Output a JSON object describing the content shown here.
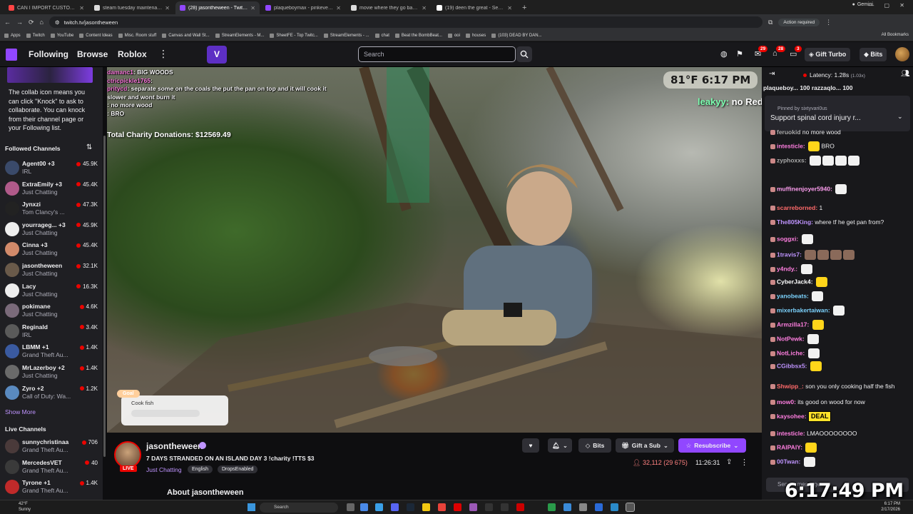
{
  "browser": {
    "tabs": [
      {
        "title": "CAN I IMPORT CUSTOM MOVIE",
        "color": "#ff4444",
        "active": false
      },
      {
        "title": "steam tuesday maintenance - G",
        "color": "#ddd",
        "active": false
      },
      {
        "title": "(28) jasontheween - Twitch",
        "color": "#9147ff",
        "active": true
      },
      {
        "title": "plaqueboymax - pinkeverywhe",
        "color": "#9147ff",
        "active": false
      },
      {
        "title": "movie where they go back in ti",
        "color": "#ddd",
        "active": false
      },
      {
        "title": "(19) deen the great - Search / X",
        "color": "#fff",
        "active": false
      }
    ],
    "new_tab": "+",
    "profile": "Gemini",
    "url": "twitch.tv/jasontheween",
    "action_required": "Action required",
    "bookmarks": [
      "Apps",
      "Twitch",
      "YouTube",
      "Content Ideas",
      "Misc. Room stuff",
      "Canvas and Wall St...",
      "StreamElements - M...",
      "SheetFE - Top Twitc...",
      "StreamElements - ...",
      "chat",
      "Beat the BombBeat...",
      "ooi",
      "houses",
      "(103) DEAD BY DAN..."
    ],
    "all_bookmarks": "All Bookmarks"
  },
  "topnav": {
    "following": "Following",
    "browse": "Browse",
    "roblox": "Roblox",
    "search_placeholder": "Search",
    "notif_count_1": "29",
    "notif_count_2": "28",
    "notif_count_3": "3",
    "gift_turbo": "Gift Turbo",
    "bits": "Bits"
  },
  "sidebar": {
    "collab_text": "The collab icon means you can click \"Knock\" to ask to collaborate. You can knock from their channel page or your Following list.",
    "followed_header": "Followed Channels",
    "followed": [
      {
        "name": "Agent00 +3",
        "game": "IRL",
        "viewers": "45.9K",
        "color": "#3a4a6a"
      },
      {
        "name": "ExtraEmily +3",
        "game": "Just Chatting",
        "viewers": "45.4K",
        "color": "#b05a8a"
      },
      {
        "name": "Jynxzi",
        "game": "Tom Clancy's ...",
        "viewers": "47.3K",
        "color": "#222"
      },
      {
        "name": "yourrageg... +3",
        "game": "Just Chatting",
        "viewers": "45.9K",
        "color": "#eee"
      },
      {
        "name": "Cinna +3",
        "game": "Just Chatting",
        "viewers": "45.4K",
        "color": "#d28a6a"
      },
      {
        "name": "jasontheween",
        "game": "Just Chatting",
        "viewers": "32.1K",
        "color": "#6a5a4a"
      },
      {
        "name": "Lacy",
        "game": "Just Chatting",
        "viewers": "16.3K",
        "color": "#eee"
      },
      {
        "name": "pokimane",
        "game": "Just Chatting",
        "viewers": "4.6K",
        "color": "#7a6a7a"
      },
      {
        "name": "Reginald",
        "game": "IRL",
        "viewers": "3.4K",
        "color": "#5a5a5a"
      },
      {
        "name": "LBMM +1",
        "game": "Grand Theft Au...",
        "viewers": "1.4K",
        "color": "#3a5aa0"
      },
      {
        "name": "MrLazerboy +2",
        "game": "Just Chatting",
        "viewers": "1.4K",
        "color": "#6a6a6a"
      },
      {
        "name": "Zyro +2",
        "game": "Call of Duty: Wa...",
        "viewers": "1.2K",
        "color": "#5a8ac0"
      }
    ],
    "show_more": "Show More",
    "live_header": "Live Channels",
    "live": [
      {
        "name": "sunnychristinaa",
        "game": "Grand Theft Au...",
        "viewers": "706",
        "color": "#4a3a3a"
      },
      {
        "name": "MercedesVET",
        "game": "Grand Theft Au...",
        "viewers": "40",
        "color": "#3a3a3a"
      },
      {
        "name": "Tyrone +1",
        "game": "Grand Theft Au...",
        "viewers": "1.4K",
        "color": "#c02a2a"
      }
    ]
  },
  "video": {
    "overlay_chat": [
      {
        "user": "damanc1",
        "text": "BIG WOODS"
      },
      {
        "user": "ctricpickle1765",
        "text": ""
      },
      {
        "user": "pritycd",
        "text": "separate some on the coals the put the pan on top and it will cook it slower and wont burn it"
      },
      {
        "user": "",
        "text": "no more wood"
      },
      {
        "user": "",
        "text": "BRO"
      }
    ],
    "charity": "Total Charity Donations: $12569.49",
    "weather": "81°F 6:17 PM",
    "leaky_user": "leakyy:",
    "leaky_text": "no Red Bull it's over for me",
    "goal_tag": "Goal",
    "goal_label": "Cook fish",
    "goal_progress": 0
  },
  "stream": {
    "name": "jasontheween",
    "live": "LIVE",
    "title": "7 DAYS STRANDED ON AN ISLAND  DAY 3  !charity !TTS $3",
    "category": "Just Chatting",
    "tags": [
      "English",
      "DropsEnabled"
    ],
    "bits": "Bits",
    "gift_sub": "Gift a Sub",
    "resub": "Resubscribe",
    "viewers": "32,112 (29 675)",
    "uptime": "11:26:31",
    "about": "About jasontheween"
  },
  "chat": {
    "latency": "Latency: 1.28s",
    "latency_sub": "(1.03x)",
    "gifters": "plaqueboy... 100   razzaqlo... 100",
    "pinned_by": "Pinned by  sixtyvari0us",
    "pinned_text": "Support spinal cord injury r...",
    "messages": [
      {
        "user": "feruokid",
        "color": "#aaaaaa",
        "text": "no more wood",
        "emotes": ""
      },
      {
        "user": "intesticle:",
        "color": "#ff7ee0",
        "text": "BRO",
        "emotes": "y"
      },
      {
        "user": "zyphoxxs:",
        "color": "#aaaaaa",
        "text": "",
        "emotes": "wwww"
      },
      {
        "user": "muffinenjoyer5940:",
        "color": "#ff9ef0",
        "text": "",
        "emotes": "w"
      },
      {
        "user": "scarreborned:",
        "color": "#ff6a6a",
        "text": "1",
        "emotes": ""
      },
      {
        "user": "The805King:",
        "color": "#bf94ff",
        "text": "where tf he get pan from?",
        "emotes": ""
      },
      {
        "user": "soggxi:",
        "color": "#ff7ee0",
        "text": "",
        "emotes": "w"
      },
      {
        "user": "1travis7:",
        "color": "#bf94ff",
        "text": "",
        "emotes": "pppp"
      },
      {
        "user": "y4ndy.:",
        "color": "#ff7ee0",
        "text": "",
        "emotes": "w"
      },
      {
        "user": "CyberJack4:",
        "color": "#ffffff",
        "text": "",
        "emotes": "y"
      },
      {
        "user": "yanobeats:",
        "color": "#7cd4ff",
        "text": "",
        "emotes": "w"
      },
      {
        "user": "mixerbakertaiwan:",
        "color": "#7cd4ff",
        "text": "",
        "emotes": "w"
      },
      {
        "user": "Armzilla17:",
        "color": "#ff7ee0",
        "text": "",
        "emotes": "y"
      },
      {
        "user": "NotPewk:",
        "color": "#ff7ee0",
        "text": "",
        "emotes": "w"
      },
      {
        "user": "NotLiche:",
        "color": "#ff7ee0",
        "text": "",
        "emotes": "w"
      },
      {
        "user": "CGibbsx5:",
        "color": "#bf94ff",
        "text": "",
        "emotes": "y"
      },
      {
        "user": "Shwipp_:",
        "color": "#ff6a6a",
        "text": "son you only cooking half the fish",
        "emotes": ""
      },
      {
        "user": "mow0:",
        "color": "#ff7ee0",
        "text": "its good on wood for now",
        "emotes": ""
      },
      {
        "user": "kaysohee:",
        "color": "#ff7ee0",
        "text": "",
        "emotes": "DEAL"
      },
      {
        "user": "intesticle:",
        "color": "#ff7ee0",
        "text": "LMAOOOOOOOO",
        "emotes": ""
      },
      {
        "user": "RAIPAIY:",
        "color": "#ff7ee0",
        "text": "",
        "emotes": "y"
      },
      {
        "user": "00Twan:",
        "color": "#bf94ff",
        "text": "",
        "emotes": "w"
      }
    ],
    "input_placeholder": "Send a message",
    "big_clock": "6:17:49 PM"
  },
  "taskbar": {
    "temp": "42°F",
    "condition": "Sunny",
    "search": "Search",
    "time": "6:17 PM",
    "date": "2/17/2026"
  }
}
